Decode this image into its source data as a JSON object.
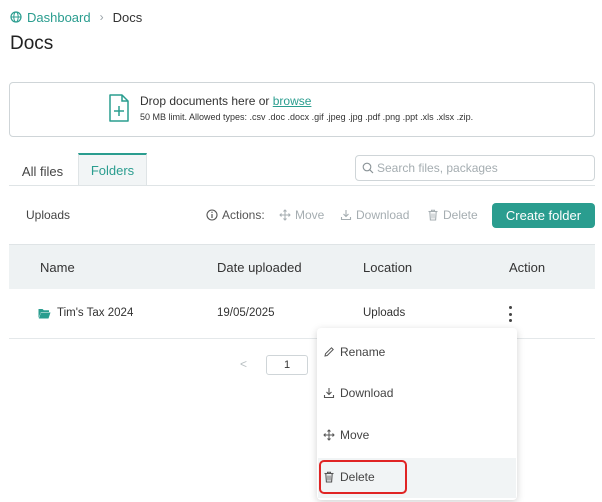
{
  "breadcrumb": {
    "home": "Dashboard",
    "current": "Docs"
  },
  "page_title": "Docs",
  "dropzone": {
    "prefix": "Drop documents here or ",
    "browse": "browse",
    "limits": "50 MB limit. Allowed types: .csv .doc .docx .gif .jpeg .jpg .pdf .png .ppt .xls .xlsx .zip."
  },
  "tabs": {
    "all_files": "All files",
    "folders": "Folders",
    "active": "Folders"
  },
  "search": {
    "placeholder": "Search files, packages",
    "value": ""
  },
  "toolbar": {
    "path": "Uploads",
    "actions_label": "Actions:",
    "move": "Move",
    "download": "Download",
    "delete": "Delete",
    "create_folder": "Create folder"
  },
  "table": {
    "columns": [
      "Name",
      "Date uploaded",
      "Location",
      "Action"
    ],
    "rows": [
      {
        "name": "Tim's Tax 2024",
        "date": "19/05/2025",
        "location": "Uploads"
      }
    ]
  },
  "pagination": {
    "prev": "<",
    "page": "1"
  },
  "context_menu": {
    "items": [
      "Rename",
      "Download",
      "Move",
      "Delete"
    ],
    "highlighted": "Delete"
  },
  "colors": {
    "accent": "#2a9d8f",
    "highlight_border": "#e02424"
  }
}
